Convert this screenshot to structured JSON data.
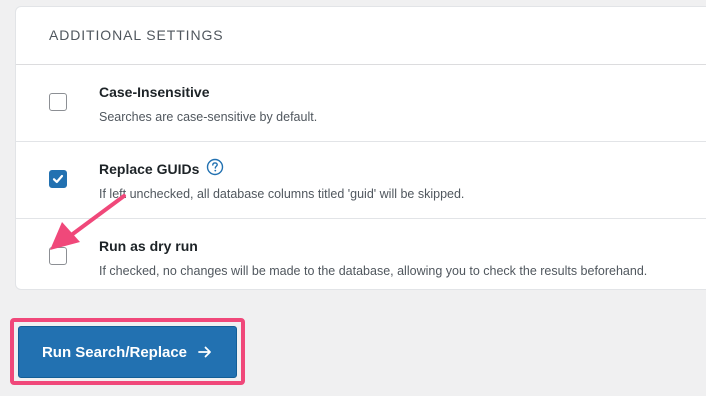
{
  "settings": {
    "title": "ADDITIONAL SETTINGS",
    "options": [
      {
        "label": "Case-Insensitive",
        "description": "Searches are case-sensitive by default.",
        "checked": false
      },
      {
        "label": "Replace GUIDs",
        "description": "If left unchecked, all database columns titled 'guid' will be skipped.",
        "checked": true,
        "help_icon": "question-circle-icon"
      },
      {
        "label": "Run as dry run",
        "description": "If checked, no changes will be made to the database, allowing you to check the results beforehand.",
        "checked": false
      }
    ]
  },
  "actions": {
    "run_label": "Run Search/Replace",
    "run_icon": "arrow-right-icon"
  },
  "annotations": {
    "arrow_color": "#f0487a",
    "highlight_color": "#f0487a"
  },
  "colors": {
    "accent": "#2271b1",
    "background": "#f0f0f1"
  }
}
